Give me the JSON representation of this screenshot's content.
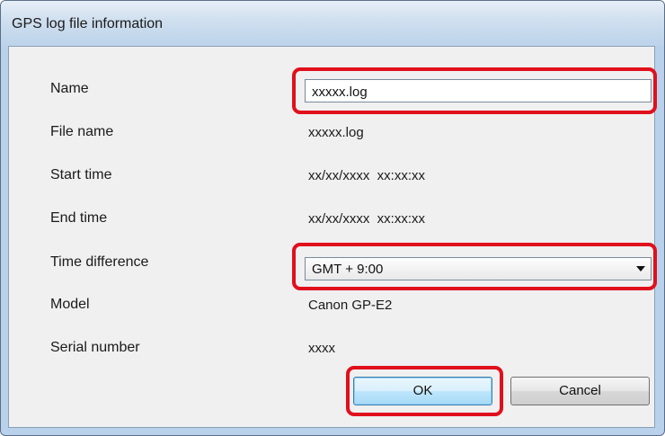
{
  "window": {
    "title": "GPS log file information"
  },
  "fields": {
    "name_label": "Name",
    "name_value": "xxxxx.log",
    "file_name_label": "File name",
    "file_name_value": "xxxxx.log",
    "start_time_label": "Start time",
    "start_time_value": "xx/xx/xxxx  xx:xx:xx",
    "end_time_label": "End time",
    "end_time_value": "xx/xx/xxxx  xx:xx:xx",
    "time_difference_label": "Time difference",
    "time_difference_value": "GMT + 9:00",
    "model_label": "Model",
    "model_value": "Canon GP-E2",
    "serial_number_label": "Serial number",
    "serial_number_value": "xxxx"
  },
  "buttons": {
    "ok_label": "OK",
    "cancel_label": "Cancel"
  },
  "colors": {
    "highlight": "#e0101c",
    "window_frame": "#b9d1ea",
    "client_bg": "#f0f0f0",
    "default_button": "#bee6fd"
  },
  "icons": {
    "dropdown": "chevron-down-icon"
  }
}
